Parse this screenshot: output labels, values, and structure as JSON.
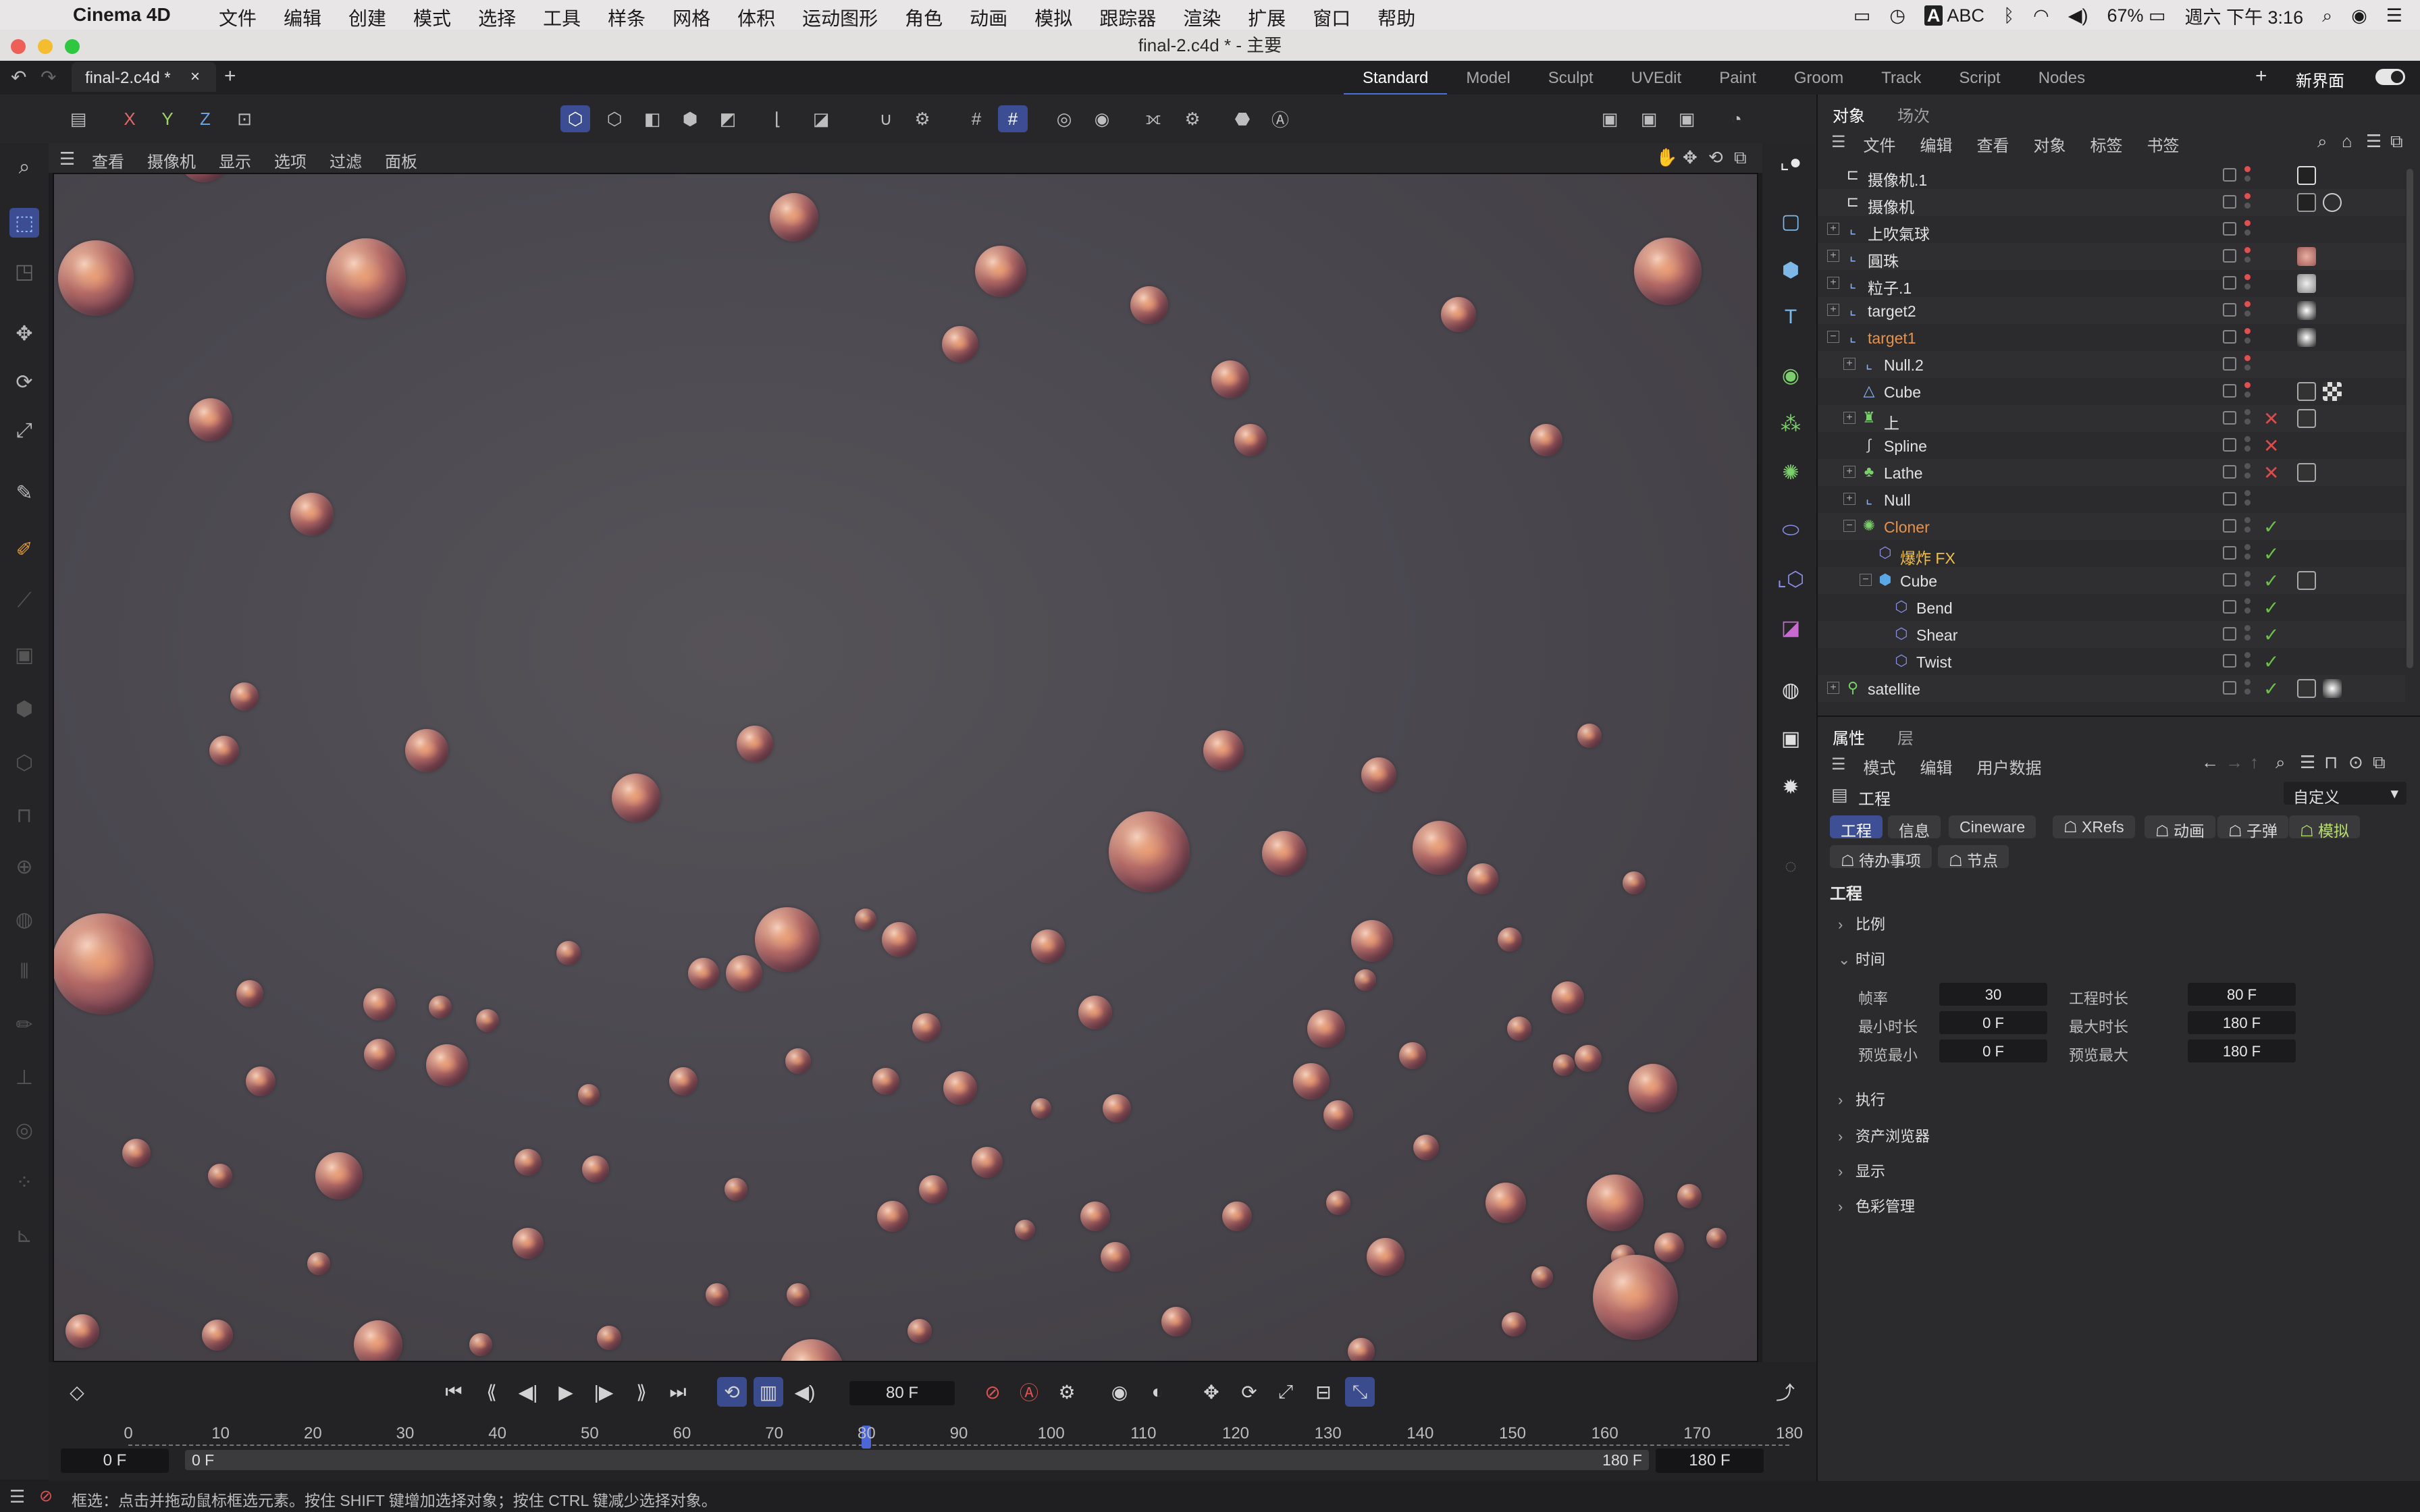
{
  "menubar": {
    "app_name": "Cinema 4D",
    "menus": [
      "文件",
      "编辑",
      "创建",
      "模式",
      "选择",
      "工具",
      "样条",
      "网格",
      "体积",
      "运动图形",
      "角色",
      "动画",
      "模拟",
      "跟踪器",
      "渲染",
      "扩展",
      "窗口",
      "帮助"
    ],
    "input_method": "ABC",
    "battery": "67%",
    "datetime": "週六 下午 3:16"
  },
  "window": {
    "title": "final-2.c4d * - 主要"
  },
  "tabs": {
    "document": "final-2.c4d *",
    "close": "×",
    "add": "+"
  },
  "layouts": [
    "Standard",
    "Model",
    "Sculpt",
    "UVEdit",
    "Paint",
    "Groom",
    "Track",
    "Script",
    "Nodes"
  ],
  "layouts_active": "Standard",
  "layout_add": "+",
  "new_interface": "新界面",
  "toolbar": {
    "x": "X",
    "y": "Y",
    "z": "Z"
  },
  "viewport_menu": [
    "查看",
    "摄像机",
    "显示",
    "选项",
    "过滤",
    "面板"
  ],
  "timeline": {
    "current_frame": "80 F",
    "ruler": [
      "0",
      "10",
      "20",
      "30",
      "40",
      "50",
      "60",
      "70",
      "80",
      "90",
      "100",
      "110",
      "120",
      "130",
      "140",
      "150",
      "160",
      "170",
      "180"
    ],
    "start": "0 F",
    "preview_start": "0 F",
    "preview_end": "180 F",
    "end": "180 F"
  },
  "status_bar": {
    "text": "框选：点击并拖动鼠标框选元素。按住 SHIFT 键增加选择对象；按住 CTRL 键减少选择对象。"
  },
  "object_panel": {
    "tabs": [
      "对象",
      "场次"
    ],
    "menu": [
      "文件",
      "编辑",
      "查看",
      "对象",
      "标签",
      "书签"
    ],
    "objects": [
      {
        "name": "摄像机.1",
        "icon": "camera-icon",
        "depth": 0,
        "expand": "",
        "color": "#e2e2e2",
        "state": ""
      },
      {
        "name": "摄像机",
        "icon": "camera-icon",
        "depth": 0,
        "expand": "",
        "color": "#e2e2e2",
        "state": ""
      },
      {
        "name": "上吹氣球",
        "icon": "null-icon",
        "depth": 0,
        "expand": "+",
        "color": "#e2e2e2",
        "state": ""
      },
      {
        "name": "圓珠",
        "icon": "null-icon",
        "depth": 0,
        "expand": "+",
        "color": "#e2e2e2",
        "state": ""
      },
      {
        "name": "粒子.1",
        "icon": "null-icon",
        "depth": 0,
        "expand": "+",
        "color": "#e2e2e2",
        "state": ""
      },
      {
        "name": "target2",
        "icon": "null-icon",
        "depth": 0,
        "expand": "+",
        "color": "#e2e2e2",
        "state": ""
      },
      {
        "name": "target1",
        "icon": "null-icon",
        "depth": 0,
        "expand": "−",
        "color": "#e8914a",
        "state": ""
      },
      {
        "name": "Null.2",
        "icon": "null-icon",
        "depth": 1,
        "expand": "+",
        "color": "#e2e2e2",
        "state": ""
      },
      {
        "name": "Cube",
        "icon": "polygon-icon",
        "depth": 1,
        "expand": "",
        "color": "#e2e2e2",
        "state": ""
      },
      {
        "name": "上",
        "icon": "bell-icon",
        "depth": 1,
        "expand": "+",
        "color": "#e2e2e2",
        "state": "x"
      },
      {
        "name": "Spline",
        "icon": "spline-icon",
        "depth": 1,
        "expand": "",
        "color": "#e2e2e2",
        "state": "x"
      },
      {
        "name": "Lathe",
        "icon": "lathe-icon",
        "depth": 1,
        "expand": "+",
        "color": "#e2e2e2",
        "state": "x"
      },
      {
        "name": "Null",
        "icon": "null-icon",
        "depth": 1,
        "expand": "+",
        "color": "#e2e2e2",
        "state": ""
      },
      {
        "name": "Cloner",
        "icon": "cloner-icon",
        "depth": 1,
        "expand": "−",
        "color": "#e8914a",
        "state": "check"
      },
      {
        "name": "爆炸 FX",
        "icon": "effector-icon",
        "depth": 2,
        "expand": "",
        "color": "#f2c04a",
        "state": "check"
      },
      {
        "name": "Cube",
        "icon": "cube-icon",
        "depth": 2,
        "expand": "−",
        "color": "#e2e2e2",
        "state": "check"
      },
      {
        "name": "Bend",
        "icon": "deformer-icon",
        "depth": 3,
        "expand": "",
        "color": "#e2e2e2",
        "state": "check"
      },
      {
        "name": "Shear",
        "icon": "deformer-icon",
        "depth": 3,
        "expand": "",
        "color": "#e2e2e2",
        "state": "check"
      },
      {
        "name": "Twist",
        "icon": "deformer-icon",
        "depth": 3,
        "expand": "",
        "color": "#e2e2e2",
        "state": "check"
      },
      {
        "name": "satellite",
        "icon": "satellite-icon",
        "depth": 0,
        "expand": "+",
        "color": "#e2e2e2",
        "state": "check"
      }
    ]
  },
  "attr_panel": {
    "tabs": [
      "属性",
      "层"
    ],
    "menu": [
      "模式",
      "编辑",
      "用户数据"
    ],
    "header": "工程",
    "preset": "自定义",
    "subtabs": [
      "工程",
      "信息",
      "Cineware",
      "XRefs",
      "动画",
      "子弹",
      "模拟"
    ],
    "subtabs2": [
      "待办事项",
      "节点"
    ],
    "section_title": "工程",
    "groups": [
      {
        "label": "比例",
        "open": false
      },
      {
        "label": "时间",
        "open": true
      },
      {
        "label": "执行",
        "open": false
      },
      {
        "label": "资产浏览器",
        "open": false
      },
      {
        "label": "显示",
        "open": false
      },
      {
        "label": "色彩管理",
        "open": false
      }
    ],
    "time_fields": {
      "fps_label": "帧率",
      "fps": "30",
      "project_len_label": "工程时长",
      "project_len": "80 F",
      "min_len_label": "最小时长",
      "min_len": "0 F",
      "max_len_label": "最大时长",
      "max_len": "180 F",
      "preview_min_label": "预览最小",
      "preview_min": "0 F",
      "preview_max_label": "预览最大",
      "preview_max": "180 F"
    }
  },
  "colors": {
    "accent": "#3e4f95",
    "orange": "#e8914a",
    "yellow": "#f2c04a",
    "check": "#6cc04a",
    "cross": "#e04a4a"
  }
}
